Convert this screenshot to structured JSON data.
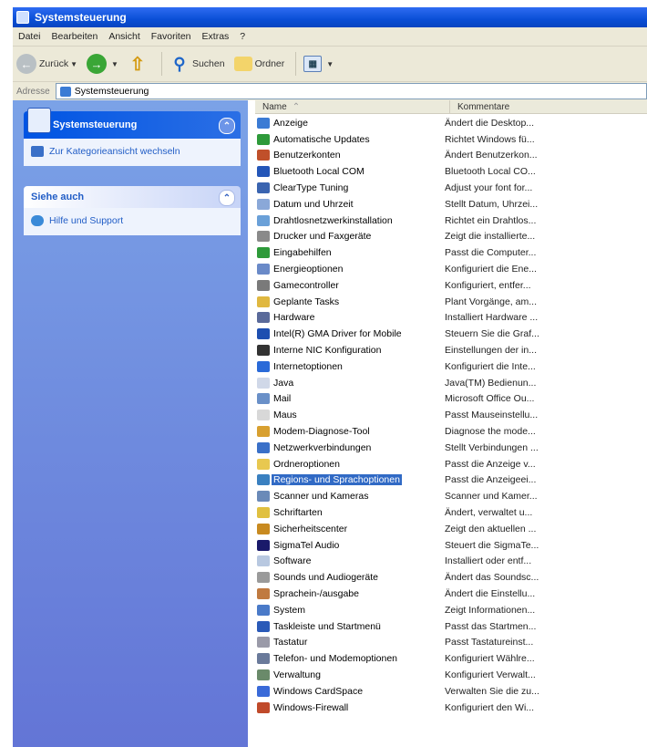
{
  "window": {
    "title": "Systemsteuerung"
  },
  "menu": [
    "Datei",
    "Bearbeiten",
    "Ansicht",
    "Favoriten",
    "Extras",
    "?"
  ],
  "toolbar": {
    "back": "Zurück",
    "search": "Suchen",
    "folders": "Ordner"
  },
  "address": {
    "label": "Adresse",
    "value": "Systemsteuerung"
  },
  "sidebar": {
    "panel1": {
      "title": "Systemsteuerung",
      "link": "Zur Kategorieansicht wechseln"
    },
    "panel2": {
      "title": "Siehe auch",
      "link": "Hilfe und Support"
    }
  },
  "columns": {
    "name": "Name",
    "comment": "Kommentare"
  },
  "items": [
    {
      "name": "Anzeige",
      "comment": "Ändert die Desktop...",
      "icon": "display-icon",
      "color": "#3b7bd4"
    },
    {
      "name": "Automatische Updates",
      "comment": "Richtet Windows fü...",
      "icon": "updates-icon",
      "color": "#2e9a3a"
    },
    {
      "name": "Benutzerkonten",
      "comment": "Ändert Benutzerkon...",
      "icon": "users-icon",
      "color": "#c0502a"
    },
    {
      "name": "Bluetooth Local COM",
      "comment": "Bluetooth Local CO...",
      "icon": "bluetooth-icon",
      "color": "#2456b8"
    },
    {
      "name": "ClearType Tuning",
      "comment": "Adjust your font for...",
      "icon": "cleartype-icon",
      "color": "#3a64b0"
    },
    {
      "name": "Datum und Uhrzeit",
      "comment": "Stellt Datum, Uhrzei...",
      "icon": "clock-icon",
      "color": "#8aa8d8"
    },
    {
      "name": "Drahtlosnetzwerkinstallation",
      "comment": "Richtet ein Drahtlos...",
      "icon": "wireless-icon",
      "color": "#6aa0d8"
    },
    {
      "name": "Drucker und Faxgeräte",
      "comment": "Zeigt die installierte...",
      "icon": "printer-icon",
      "color": "#8a8a8a"
    },
    {
      "name": "Eingabehilfen",
      "comment": "Passt die Computer...",
      "icon": "accessibility-icon",
      "color": "#2e9a3a"
    },
    {
      "name": "Energieoptionen",
      "comment": "Konfiguriert die Ene...",
      "icon": "power-icon",
      "color": "#6a8ac8"
    },
    {
      "name": "Gamecontroller",
      "comment": "Konfiguriert, entfer...",
      "icon": "gamepad-icon",
      "color": "#7a7a7a"
    },
    {
      "name": "Geplante Tasks",
      "comment": "Plant Vorgänge, am...",
      "icon": "tasks-icon",
      "color": "#e0b840"
    },
    {
      "name": "Hardware",
      "comment": "Installiert Hardware ...",
      "icon": "hardware-icon",
      "color": "#5a6a9a"
    },
    {
      "name": "Intel(R) GMA Driver for Mobile",
      "comment": "Steuern Sie die Graf...",
      "icon": "intel-icon",
      "color": "#1e4fb0"
    },
    {
      "name": "Interne NIC Konfiguration",
      "comment": "Einstellungen der in...",
      "icon": "network-card-icon",
      "color": "#333333"
    },
    {
      "name": "Internetoptionen",
      "comment": "Konfiguriert die Inte...",
      "icon": "internet-icon",
      "color": "#2a6ad8"
    },
    {
      "name": "Java",
      "comment": "Java(TM) Bedienun...",
      "icon": "java-icon",
      "color": "#d0d8e8"
    },
    {
      "name": "Mail",
      "comment": "Microsoft Office Ou...",
      "icon": "mail-icon",
      "color": "#6a90c8"
    },
    {
      "name": "Maus",
      "comment": "Passt Mauseinstellu...",
      "icon": "mouse-icon",
      "color": "#d8d8d8"
    },
    {
      "name": "Modem-Diagnose-Tool",
      "comment": "Diagnose the mode...",
      "icon": "modem-icon",
      "color": "#d8a030"
    },
    {
      "name": "Netzwerkverbindungen",
      "comment": "Stellt Verbindungen ...",
      "icon": "network-icon",
      "color": "#3a70c8"
    },
    {
      "name": "Ordneroptionen",
      "comment": "Passt die Anzeige v...",
      "icon": "folder-icon",
      "color": "#e8c850"
    },
    {
      "name": "Regions- und Sprachoptionen",
      "comment": "Passt die Anzeigeei...",
      "icon": "globe-icon",
      "color": "#3a80c0"
    },
    {
      "name": "Scanner und Kameras",
      "comment": "Scanner und Kamer...",
      "icon": "scanner-icon",
      "color": "#6a8ab8"
    },
    {
      "name": "Schriftarten",
      "comment": "Ändert, verwaltet u...",
      "icon": "fonts-icon",
      "color": "#e0c040"
    },
    {
      "name": "Sicherheitscenter",
      "comment": "Zeigt den aktuellen ...",
      "icon": "shield-icon",
      "color": "#c88a20"
    },
    {
      "name": "SigmaTel Audio",
      "comment": "Steuert die SigmaTe...",
      "icon": "audio-icon",
      "color": "#1a1a6a"
    },
    {
      "name": "Software",
      "comment": "Installiert oder entf...",
      "icon": "software-icon",
      "color": "#b8c8e0"
    },
    {
      "name": "Sounds und Audiogeräte",
      "comment": "Ändert das Soundsc...",
      "icon": "speaker-icon",
      "color": "#9a9a9a"
    },
    {
      "name": "Sprachein-/ausgabe",
      "comment": "Ändert die Einstellu...",
      "icon": "speech-icon",
      "color": "#c07a40"
    },
    {
      "name": "System",
      "comment": "Zeigt Informationen...",
      "icon": "system-icon",
      "color": "#4a7ac8"
    },
    {
      "name": "Taskleiste und Startmenü",
      "comment": "Passt das Startmen...",
      "icon": "taskbar-icon",
      "color": "#2a5ab8"
    },
    {
      "name": "Tastatur",
      "comment": "Passt Tastatureinst...",
      "icon": "keyboard-icon",
      "color": "#9a9aa8"
    },
    {
      "name": "Telefon- und Modemoptionen",
      "comment": "Konfiguriert Wählre...",
      "icon": "phone-icon",
      "color": "#6a7a9a"
    },
    {
      "name": "Verwaltung",
      "comment": "Konfiguriert Verwalt...",
      "icon": "admin-icon",
      "color": "#6a8a6a"
    },
    {
      "name": "Windows CardSpace",
      "comment": "Verwalten Sie die zu...",
      "icon": "cardspace-icon",
      "color": "#3a6ad8"
    },
    {
      "name": "Windows-Firewall",
      "comment": "Konfiguriert den Wi...",
      "icon": "firewall-icon",
      "color": "#c04a2a"
    }
  ],
  "selected_index": 22
}
